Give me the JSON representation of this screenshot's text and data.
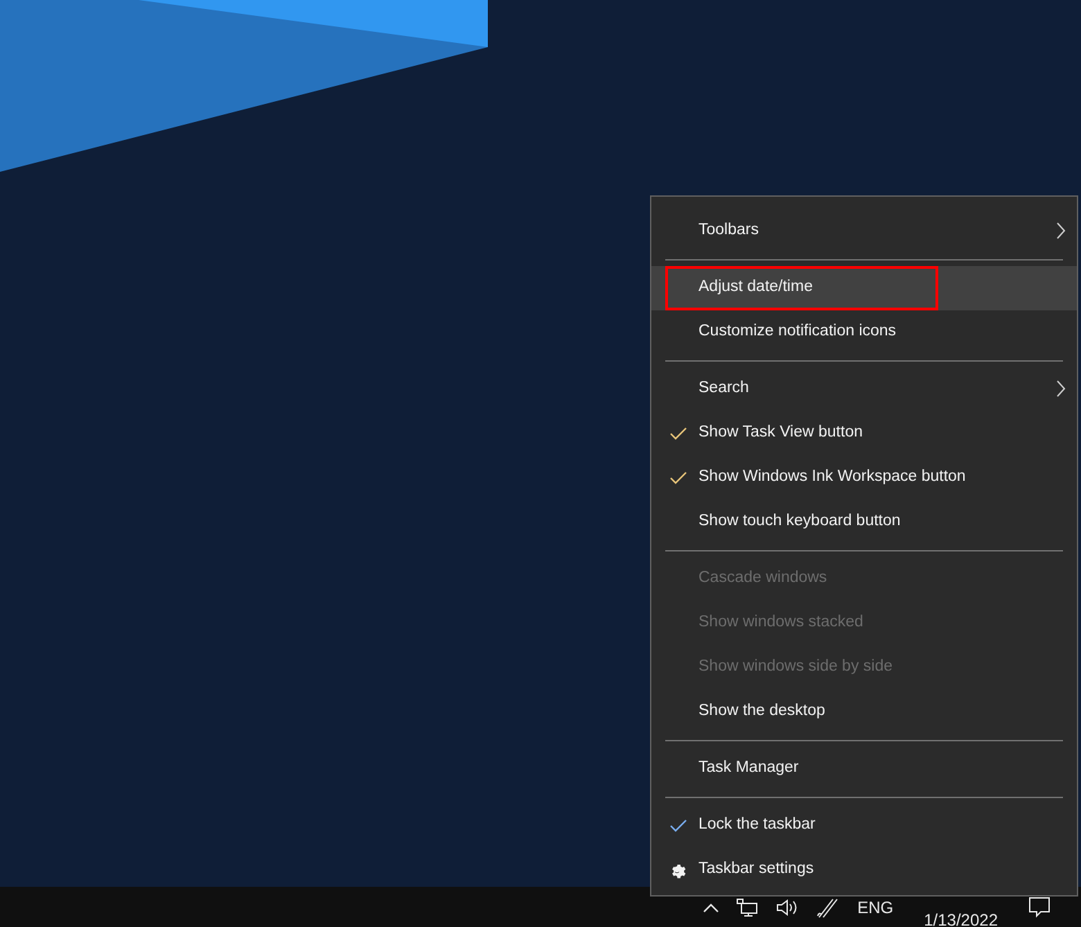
{
  "context_menu": {
    "items": [
      {
        "kind": "item",
        "label": "Toolbars",
        "checked": false,
        "disabled": false,
        "submenu": true,
        "highlighted": false,
        "annotated": false
      },
      {
        "kind": "separator"
      },
      {
        "kind": "item",
        "label": "Adjust date/time",
        "checked": false,
        "disabled": false,
        "submenu": false,
        "highlighted": true,
        "annotated": true
      },
      {
        "kind": "item",
        "label": "Customize notification icons",
        "checked": false,
        "disabled": false,
        "submenu": false,
        "highlighted": false,
        "annotated": false
      },
      {
        "kind": "separator"
      },
      {
        "kind": "item",
        "label": "Search",
        "checked": false,
        "disabled": false,
        "submenu": true,
        "highlighted": false,
        "annotated": false
      },
      {
        "kind": "item",
        "label": "Show Task View button",
        "checked": true,
        "disabled": false,
        "submenu": false,
        "highlighted": false,
        "annotated": false
      },
      {
        "kind": "item",
        "label": "Show Windows Ink Workspace button",
        "checked": true,
        "disabled": false,
        "submenu": false,
        "highlighted": false,
        "annotated": false
      },
      {
        "kind": "item",
        "label": "Show touch keyboard button",
        "checked": false,
        "disabled": false,
        "submenu": false,
        "highlighted": false,
        "annotated": false
      },
      {
        "kind": "separator"
      },
      {
        "kind": "item",
        "label": "Cascade windows",
        "checked": false,
        "disabled": true,
        "submenu": false,
        "highlighted": false,
        "annotated": false
      },
      {
        "kind": "item",
        "label": "Show windows stacked",
        "checked": false,
        "disabled": true,
        "submenu": false,
        "highlighted": false,
        "annotated": false
      },
      {
        "kind": "item",
        "label": "Show windows side by side",
        "checked": false,
        "disabled": true,
        "submenu": false,
        "highlighted": false,
        "annotated": false
      },
      {
        "kind": "item",
        "label": "Show the desktop",
        "checked": false,
        "disabled": false,
        "submenu": false,
        "highlighted": false,
        "annotated": false
      },
      {
        "kind": "separator"
      },
      {
        "kind": "item",
        "label": "Task Manager",
        "checked": false,
        "disabled": false,
        "submenu": false,
        "highlighted": false,
        "annotated": false
      },
      {
        "kind": "separator"
      },
      {
        "kind": "item",
        "label": "Lock the taskbar",
        "checked": true,
        "disabled": false,
        "submenu": false,
        "highlighted": false,
        "annotated": false
      },
      {
        "kind": "gear-item",
        "label": "Taskbar settings",
        "checked": false,
        "disabled": false,
        "submenu": false,
        "highlighted": false,
        "annotated": false
      }
    ]
  },
  "taskbar": {
    "language": "ENG",
    "date": "1/13/2022"
  }
}
